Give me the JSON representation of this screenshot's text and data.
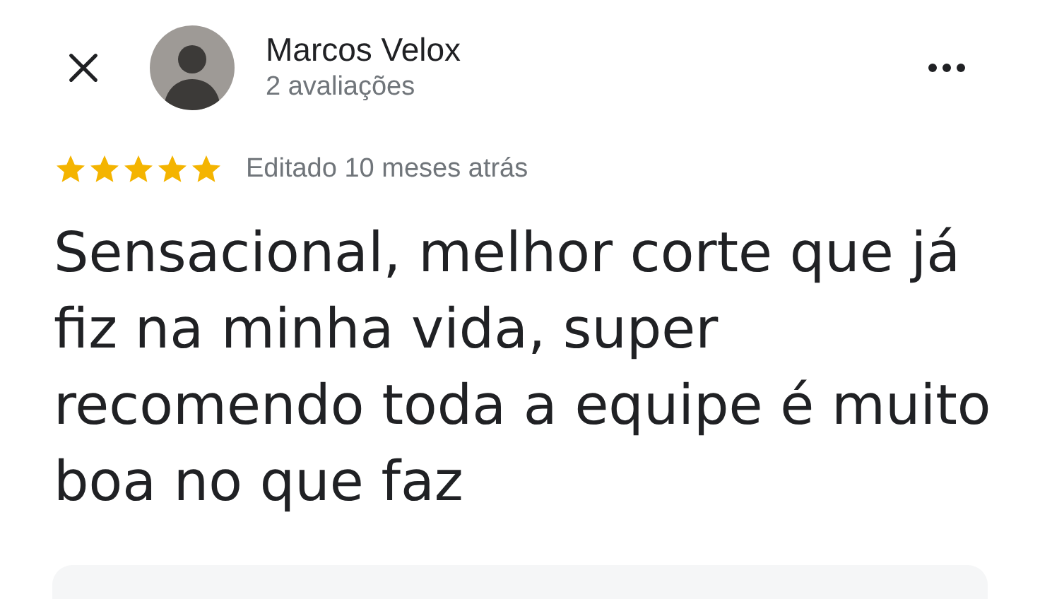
{
  "reviewer": {
    "name": "Marcos Velox",
    "review_count": "2 avaliações"
  },
  "review": {
    "stars": 5,
    "date": "Editado 10 meses atrás",
    "text": "Sensacional, melhor corte que já fiz na minha vida, super recomendo toda a equipe é muito boa no que faz"
  }
}
